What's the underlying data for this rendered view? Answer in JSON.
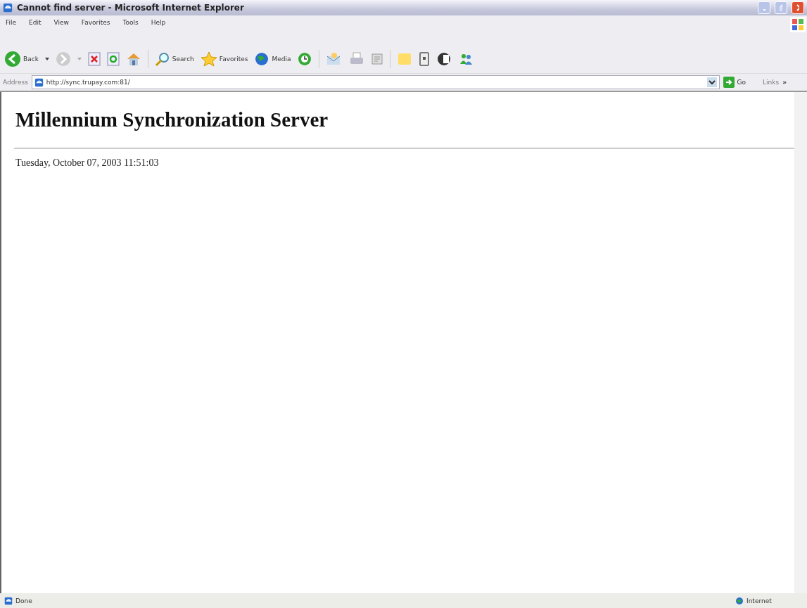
{
  "window": {
    "title": "Cannot find server - Microsoft Internet Explorer"
  },
  "menu": [
    "File",
    "Edit",
    "View",
    "Favorites",
    "Tools",
    "Help"
  ],
  "toolbar": {
    "back": "Back",
    "search": "Search",
    "favorites": "Favorites",
    "media": "Media"
  },
  "address_bar": {
    "label": "Address",
    "value": "http://sync.trupay.com:81/",
    "go": "Go",
    "links": "Links",
    "more": "»"
  },
  "page": {
    "heading": "Millennium Synchronization Server",
    "date": "Tuesday, October 07, 2003 11:51:03"
  },
  "status_bar": {
    "text": "Done",
    "zone": "Internet"
  }
}
